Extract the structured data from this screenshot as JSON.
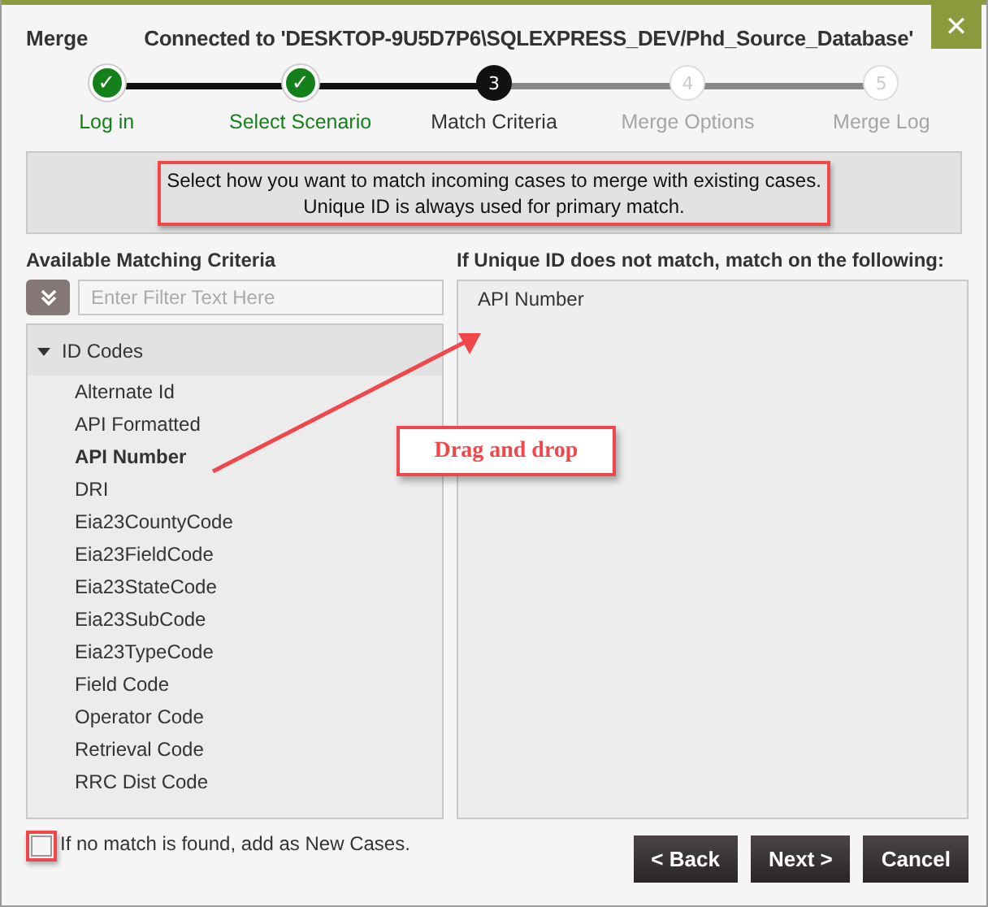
{
  "window": {
    "title": "Merge",
    "connection": "Connected to 'DESKTOP-9U5D7P6\\SQLEXPRESS_DEV/Phd_Source_Database'",
    "close": "✕"
  },
  "steps": [
    {
      "marker": "✓",
      "label": "Log in",
      "completed": true,
      "selected": false
    },
    {
      "marker": "✓",
      "label": "Select Scenario",
      "completed": true,
      "selected": false
    },
    {
      "marker": "3",
      "label": "Match Criteria",
      "completed": false,
      "selected": true
    },
    {
      "marker": "4",
      "label": "Merge Options",
      "completed": false,
      "selected": false
    },
    {
      "marker": "5",
      "label": "Merge Log",
      "completed": false,
      "selected": false
    }
  ],
  "info": {
    "lines": [
      "Select how you want to match incoming cases to merge with existing cases.",
      "Unique ID is always used for primary match."
    ],
    "highlighted": true
  },
  "available": {
    "heading": "Available Matching Criteria",
    "filter": {
      "placeholder": "Enter Filter Text Here"
    },
    "groups": [
      {
        "label": "ID Codes",
        "expanded": true,
        "children": [
          {
            "label": "Alternate Id",
            "selected": false
          },
          {
            "label": "API Formatted",
            "selected": false
          },
          {
            "label": "API Number",
            "selected": true
          },
          {
            "label": "DRI",
            "selected": false
          },
          {
            "label": "Eia23CountyCode",
            "selected": false
          },
          {
            "label": "Eia23FieldCode",
            "selected": false
          },
          {
            "label": "Eia23StateCode",
            "selected": false
          },
          {
            "label": "Eia23SubCode",
            "selected": false
          },
          {
            "label": "Eia23TypeCode",
            "selected": false
          },
          {
            "label": "Field Code",
            "selected": false
          },
          {
            "label": "Operator Code",
            "selected": false
          },
          {
            "label": "Retrieval Code",
            "selected": false
          },
          {
            "label": "RRC Dist Code",
            "selected": false
          }
        ]
      }
    ]
  },
  "matching": {
    "heading": "If Unique ID does not match, match on the following:",
    "items": [
      "API Number"
    ]
  },
  "callout": {
    "text": "Drag and drop"
  },
  "new_cases": {
    "label": "If no match is found, add as New Cases.",
    "checked": false,
    "highlighted": true
  },
  "buttons": [
    "< Back",
    "Next >",
    "Cancel"
  ]
}
